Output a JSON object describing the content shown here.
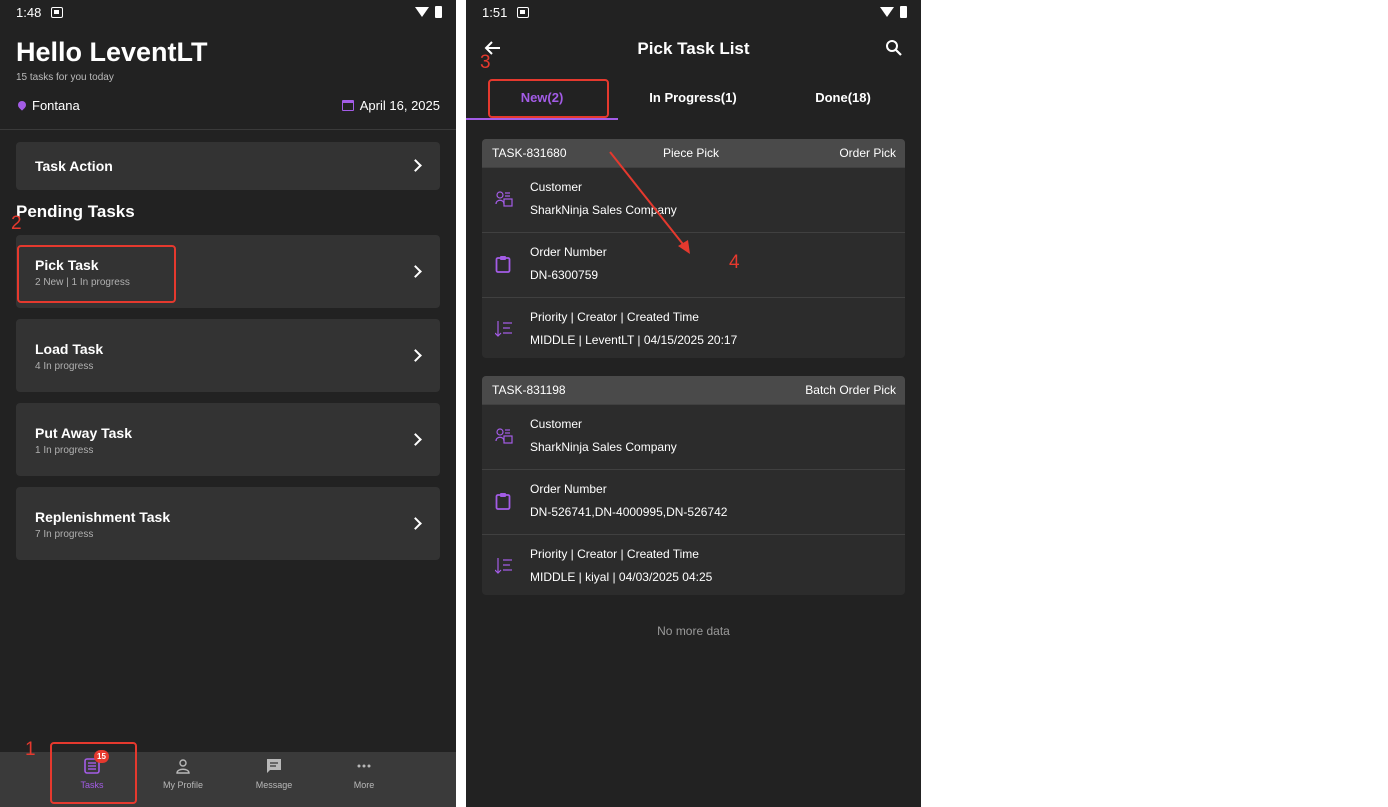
{
  "colors": {
    "accent": "#a35ce6",
    "annotation": "#e5392e",
    "background": "#222222",
    "card": "#333333"
  },
  "home": {
    "status": {
      "time": "1:48"
    },
    "greeting": "Hello LeventLT",
    "subtitle": "15 tasks for you today",
    "location": "Fontana",
    "date": "April 16, 2025",
    "task_action": "Task Action",
    "pending_title": "Pending Tasks",
    "tasks": [
      {
        "title": "Pick Task",
        "meta": "2 New | 1 In progress"
      },
      {
        "title": "Load Task",
        "meta": "4 In progress"
      },
      {
        "title": "Put Away Task",
        "meta": "1 In progress"
      },
      {
        "title": "Replenishment Task",
        "meta": "7 In progress"
      }
    ],
    "nav": [
      {
        "label": "Tasks",
        "icon": "tasks-icon",
        "badge": "15",
        "active": true
      },
      {
        "label": "My Profile",
        "icon": "profile-icon"
      },
      {
        "label": "Message",
        "icon": "message-icon"
      },
      {
        "label": "More",
        "icon": "more-icon"
      }
    ]
  },
  "picklist": {
    "status": {
      "time": "1:51"
    },
    "title": "Pick Task List",
    "tabs": [
      "New(2)",
      "In Progress(1)",
      "Done(18)"
    ],
    "cards": [
      {
        "id": "TASK-831680",
        "type": "Piece Pick",
        "kind": "Order Pick",
        "customer_label": "Customer",
        "customer": "SharkNinja Sales Company",
        "order_label": "Order Number",
        "order": "DN-6300759",
        "priority_label": "Priority | Creator | Created Time",
        "priority": "MIDDLE | LeventLT | 04/15/2025 20:17"
      },
      {
        "id": "TASK-831198",
        "type": "",
        "kind": "Batch Order Pick",
        "customer_label": "Customer",
        "customer": "SharkNinja Sales Company",
        "order_label": "Order Number",
        "order": "DN-526741,DN-4000995,DN-526742",
        "priority_label": "Priority | Creator | Created Time",
        "priority": "MIDDLE | kiyal | 04/03/2025 04:25"
      }
    ],
    "no_more": "No more data"
  },
  "annotations": [
    "1",
    "2",
    "3",
    "4"
  ]
}
